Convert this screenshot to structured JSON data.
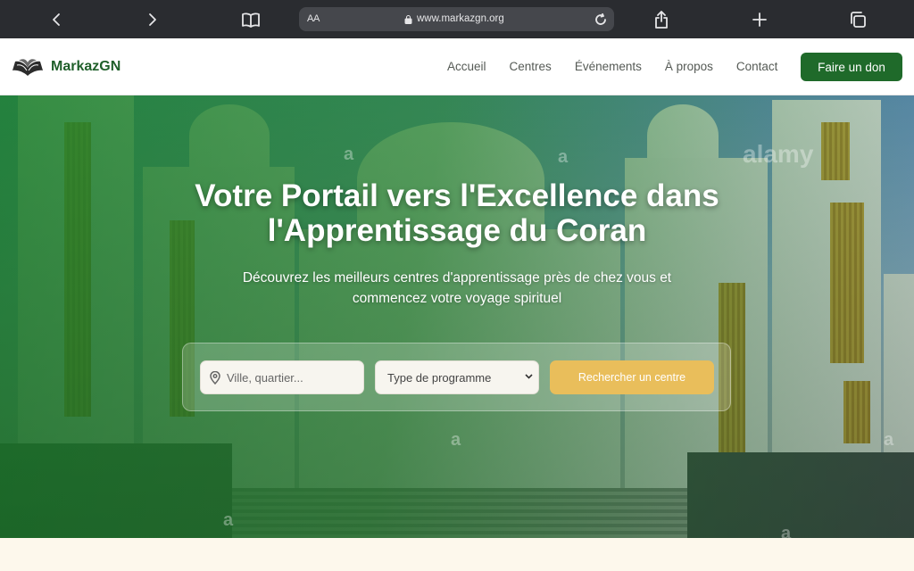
{
  "browser": {
    "text_size_label": "AA",
    "url": "www.markazgn.org"
  },
  "header": {
    "brand": "MarkazGN",
    "nav": [
      "Accueil",
      "Centres",
      "Événements",
      "À propos",
      "Contact"
    ],
    "donate_label": "Faire un don"
  },
  "hero": {
    "title_line1": "Votre Portail vers l'Excellence dans",
    "title_line2": "l'Apprentissage du Coran",
    "subtitle_line1": "Découvrez les meilleurs centres d'apprentissage près de chez vous et",
    "subtitle_line2": "commencez votre voyage spirituel",
    "search": {
      "location_placeholder": "Ville, quartier...",
      "program_selected": "Type de programme",
      "button_label": "Rechercher un centre"
    },
    "watermarks": [
      "a",
      "alamy",
      "a",
      "a",
      "a",
      "a",
      "a"
    ]
  },
  "colors": {
    "brand_green": "#1f6a2a",
    "accent_gold": "#e9be5b"
  }
}
